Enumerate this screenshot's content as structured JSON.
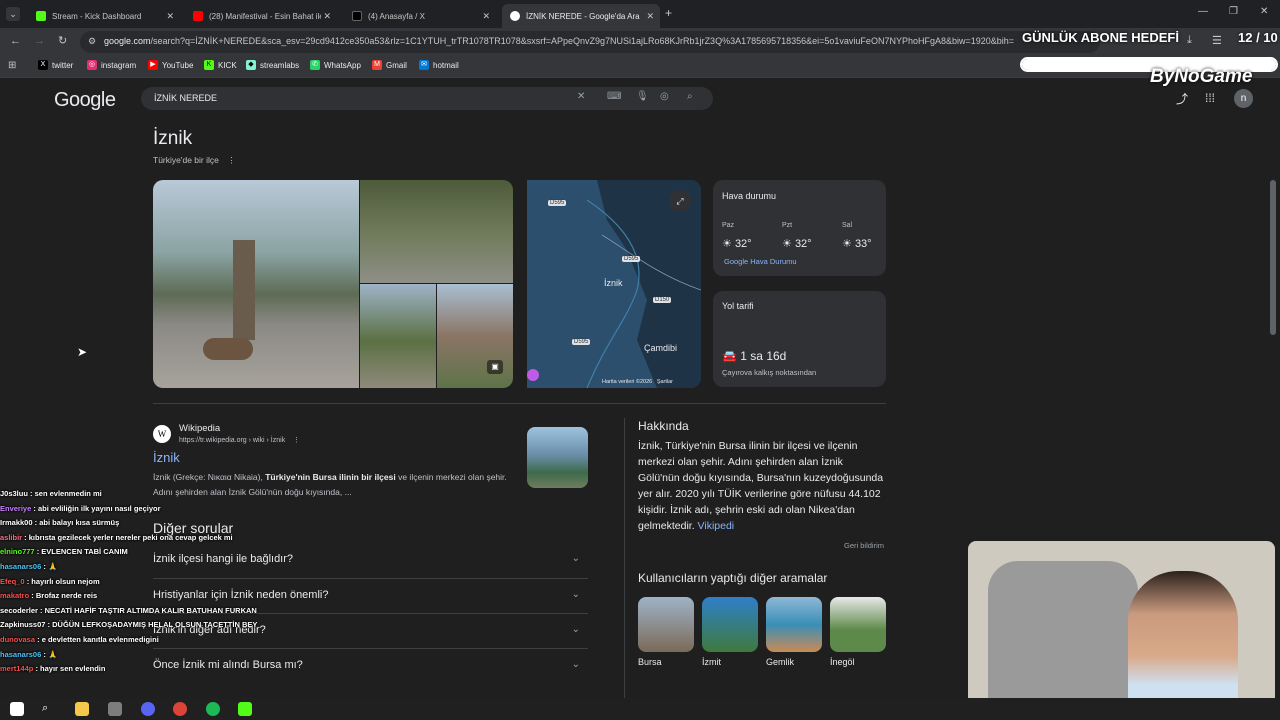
{
  "browser": {
    "tabs": [
      {
        "label": "Stream - Kick Dashboard",
        "color": "#53fc18"
      },
      {
        "label": "(28) Manifestival - Esin Bahat ile",
        "color": "#ff0000"
      },
      {
        "label": "(4) Anasayfa / X",
        "color": "#000000"
      },
      {
        "label": "İZNİK NEREDE - Google'da Ara",
        "color": "#4285f4"
      }
    ],
    "url_host": "google.com",
    "url_rest": "/search?q=İZNİK+NEREDE&sca_esv=29cd9412ce350a53&rlz=1C1YTUH_trTR1078TR1078&sxsrf=APpeQnvZ9g7NUSi1ajLRo68KJrRb1jrZ3Q%3A1785695718356&ei=5o1vaviuFeON7NYPhoHFgA8&biw=1920&bih=",
    "bookmarks": [
      {
        "label": "twitter",
        "color": "#000000",
        "glyph": "X"
      },
      {
        "label": "instagram",
        "color": "#e1306c",
        "glyph": "◎"
      },
      {
        "label": "YouTube",
        "color": "#ff0000",
        "glyph": "▶"
      },
      {
        "label": "KICK",
        "color": "#53fc18",
        "glyph": "K"
      },
      {
        "label": "streamlabs",
        "color": "#80f5d2",
        "glyph": "◆"
      },
      {
        "label": "WhatsApp",
        "color": "#25d366",
        "glyph": "✆"
      },
      {
        "label": "Gmail",
        "color": "#ea4335",
        "glyph": "M"
      },
      {
        "label": "hotmail",
        "color": "#0078d4",
        "glyph": "✉"
      }
    ]
  },
  "search": {
    "logo": "Google",
    "query": "İZNİK NEREDE"
  },
  "entity": {
    "title": "İznik",
    "subtitle": "Türkiye'de bir ilçe"
  },
  "map": {
    "place": "İznik",
    "place2": "Çamdibi",
    "roads": [
      "D595",
      "D595",
      "D150",
      "D595"
    ],
    "footer": "Harita verileri ©2026",
    "terms": "Şartlar"
  },
  "weather": {
    "title": "Hava durumu",
    "days": [
      {
        "day": "Paz",
        "temp": "32°"
      },
      {
        "day": "Pzt",
        "temp": "32°"
      },
      {
        "day": "Sal",
        "temp": "33°"
      }
    ],
    "source": "Google Hava Durumu"
  },
  "directions": {
    "title": "Yol tarifi",
    "duration": "1 sa 16d",
    "from": "Çayırova kalkış noktasından"
  },
  "wiki_result": {
    "source": "Wikipedia",
    "url": "https://tr.wikipedia.org › wiki › İznik",
    "title": "İznik",
    "snippet_pre": "İznik (Grekçe: Νικαια Nikaia), ",
    "snippet_bold": "Türkiye'nin Bursa ilinin bir ilçesi",
    "snippet_post": " ve ilçenin merkezi olan şehir. Adını şehirden alan İznik Gölü'nün doğu kıyısında, ..."
  },
  "about": {
    "heading": "Hakkında",
    "text": "İznik, Türkiye'nin Bursa ilinin bir ilçesi ve ilçenin merkezi olan şehir. Adını şehirden alan İznik Gölü'nün doğu kıyısında, Bursa'nın kuzeydoğusunda yer alır. 2020 yılı TÜİK verilerine göre nüfusu 44.102 kişidir. İznik adı, şehrin eski adı olan Nikea'dan gelmektedir.",
    "link": "Vikipedi",
    "feedback": "Geri bildirim"
  },
  "faq": {
    "heading": "Diğer sorular",
    "items": [
      "İznik ilçesi hangi ile bağlıdır?",
      "Hristiyanlar için İznik neden önemli?",
      "İznik'in diğer adı nedir?",
      "Önce İznik mi alındı Bursa mı?"
    ]
  },
  "related": {
    "heading": "Kullanıcıların yaptığı diğer aramalar",
    "items": [
      {
        "label": "Bursa",
        "color": "#7b6a58"
      },
      {
        "label": "İzmit",
        "color": "#2f7fc8"
      },
      {
        "label": "Gemlik",
        "color": "#3a8fb7"
      },
      {
        "label": "İnegöl",
        "color": "#5d8a4a"
      }
    ]
  },
  "chat": [
    {
      "user": "J0s3luu",
      "color": "#ffffff",
      "msg": "sen evlenmedin mi"
    },
    {
      "user": "Enveriye",
      "color": "#c77dff",
      "msg": "abi evliliğin ilk yayını nasıl geçiyor"
    },
    {
      "user": "Irmakk00",
      "color": "#ffffff",
      "msg": "abi balayı kısa sürmüş"
    },
    {
      "user": "aslibir",
      "color": "#ff6b81",
      "msg": "kıbrısta gezilecek yerler nereler peki ona cevap gelcek mi"
    },
    {
      "user": "elnino777",
      "color": "#53fc18",
      "msg": "EVLENCEN TABİ CANIM"
    },
    {
      "user": "hasanars06",
      "color": "#4fc3f7",
      "msg": "🙏"
    },
    {
      "user": "Efeq_0",
      "color": "#ff4d4d",
      "msg": "hayırlı olsun nejom"
    },
    {
      "user": "makatro",
      "color": "#ff4d4d",
      "msg": "Brofaz nerde reis"
    },
    {
      "user": "secoderler",
      "color": "#ffffff",
      "msg": "NECATİ HAFİF TAŞTIR ALTIMDA KALIR BATUHAN FURKAN"
    },
    {
      "user": "Zapkinuss07",
      "color": "#ffffff",
      "msg": "DÜĞÜN LEFKOŞADAYMIŞ HELAL OLSUN TACETTİN BEY"
    },
    {
      "user": "dunovasa",
      "color": "#ff4d4d",
      "msg": "e devletten kanıtla evlenmedigini"
    },
    {
      "user": "hasanars06",
      "color": "#4fc3f7",
      "msg": "🙏"
    },
    {
      "user": "mert144p",
      "color": "#ff4d4d",
      "msg": "hayır sen evlendin"
    }
  ],
  "overlay": {
    "goal_label": "GÜNLÜK ABONE HEDEFİ",
    "goal_count": "12 / 10",
    "goal_progress": 1.0,
    "brand": "ByNoGame"
  }
}
